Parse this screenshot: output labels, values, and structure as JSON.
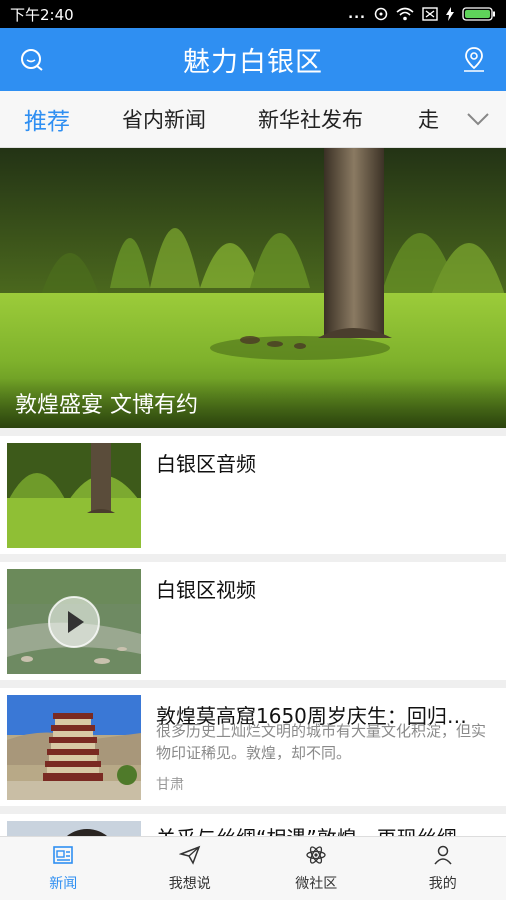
{
  "status_bar": {
    "time": "下午2:40",
    "dots": "..."
  },
  "header": {
    "title": "魅力白银区",
    "left_icon": "search-chat-icon",
    "right_icon": "location-pin-icon"
  },
  "tabs": [
    {
      "label": "推荐",
      "active": true
    },
    {
      "label": "省内新闻",
      "active": false
    },
    {
      "label": "新华社发布",
      "active": false
    },
    {
      "label": "走",
      "active": false
    }
  ],
  "tabs_more_icon": "chevron-down-icon",
  "hero": {
    "caption": "敦煌盛宴 文博有约"
  },
  "list": [
    {
      "title": "白银区音频",
      "thumb": "tree-grass-photo"
    },
    {
      "title": "白银区视频",
      "thumb": "river-video-thumbnail"
    },
    {
      "title": "敦煌莫高窟1650周岁庆生：回归…",
      "summary": "很多历史上灿烂文明的城市有大量文化积淀，但实物印证稀见。敦煌，却不同。",
      "source": "甘肃",
      "thumb": "mogao-pagoda-photo"
    },
    {
      "title": "关乎与丝绸“相遇”敦煌，再现丝绸…",
      "thumb": "portrait-photo"
    }
  ],
  "bottom_nav": [
    {
      "label": "新闻",
      "icon": "news-icon",
      "active": true
    },
    {
      "label": "我想说",
      "icon": "paper-plane-icon",
      "active": false
    },
    {
      "label": "微社区",
      "icon": "atom-icon",
      "active": false
    },
    {
      "label": "我的",
      "icon": "user-icon",
      "active": false
    }
  ],
  "colors": {
    "accent": "#2f8ff2",
    "header_bg": "#2f8ff2",
    "statusbar_bg": "#000000"
  }
}
